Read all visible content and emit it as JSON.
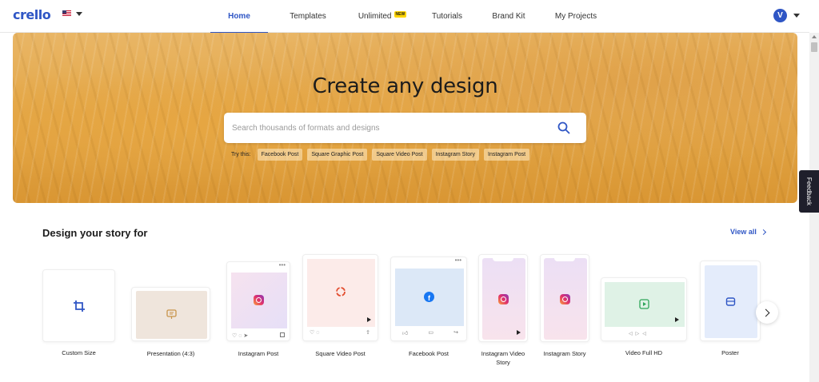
{
  "brand": {
    "logo": "crello",
    "accent": "#2f56c5"
  },
  "nav": {
    "items": [
      {
        "label": "Home",
        "active": true
      },
      {
        "label": "Templates"
      },
      {
        "label": "Unlimited",
        "badge": "NEW"
      },
      {
        "label": "Tutorials"
      },
      {
        "label": "Brand Kit"
      },
      {
        "label": "My Projects"
      }
    ]
  },
  "account": {
    "initial": "V"
  },
  "hero": {
    "title": "Create any design",
    "search_placeholder": "Search thousands of formats and designs",
    "try_label": "Try this:",
    "suggestions": [
      "Facebook Post",
      "Square Graphic Post",
      "Square Video Post",
      "Instagram Story",
      "Instagram Post"
    ]
  },
  "feedback": "Feedback",
  "section": {
    "title": "Design your story for",
    "view_all": "View all",
    "formats": [
      {
        "label": "Custom Size",
        "icon": "crop-icon"
      },
      {
        "label": "Presentation (4:3)",
        "icon": "presentation-icon"
      },
      {
        "label": "Instagram Post",
        "icon": "instagram-icon"
      },
      {
        "label": "Square Video Post",
        "icon": "loop-icon"
      },
      {
        "label": "Facebook Post",
        "icon": "facebook-icon"
      },
      {
        "label": "Instagram Video Story",
        "icon": "instagram-icon"
      },
      {
        "label": "Instagram Story",
        "icon": "instagram-icon"
      },
      {
        "label": "Video Full HD",
        "icon": "play-icon"
      },
      {
        "label": "Poster",
        "icon": "poster-icon"
      }
    ]
  }
}
